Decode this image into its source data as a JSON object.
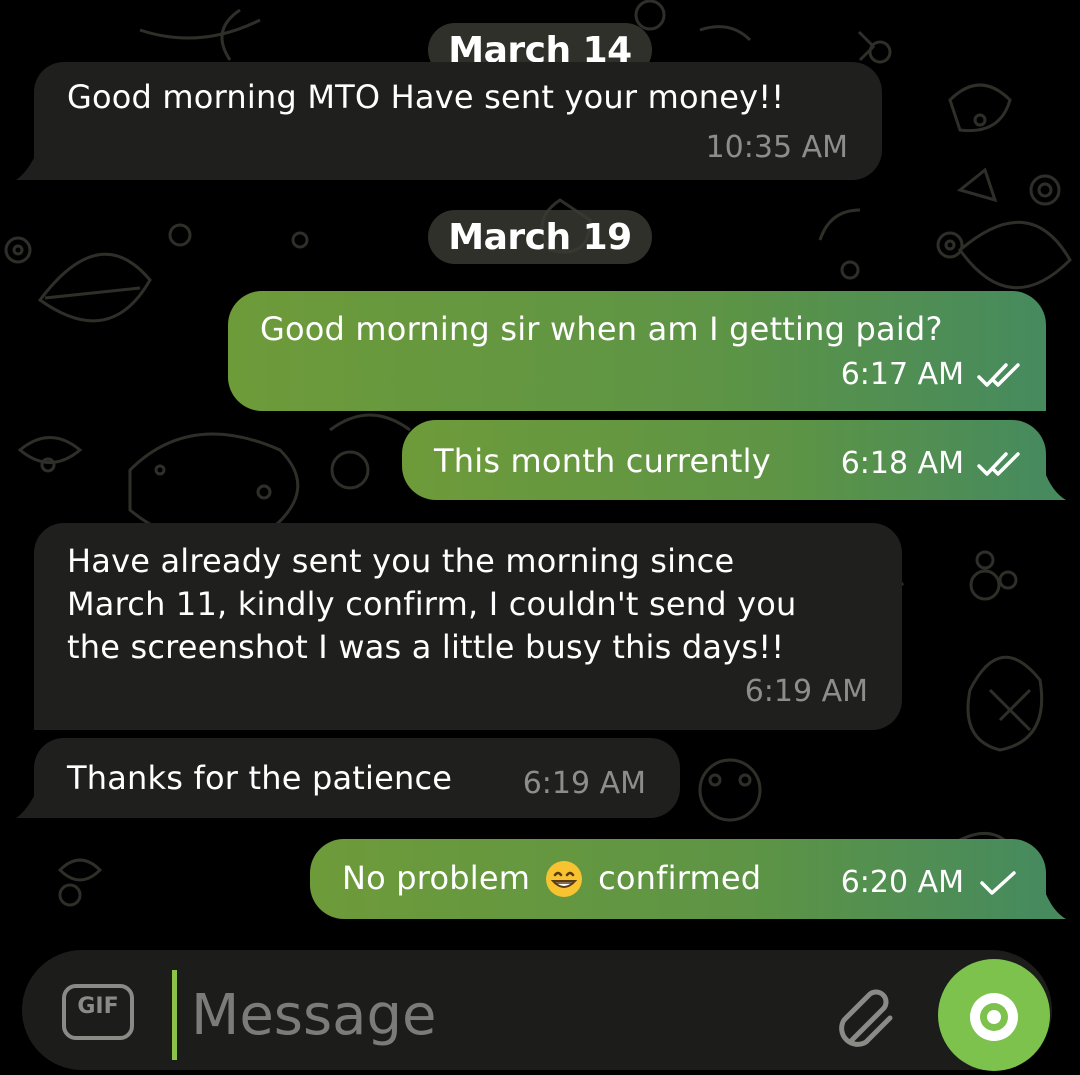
{
  "theme": {
    "background": "#000000",
    "incoming_bubble": "#1f201e",
    "outgoing_bubble_start": "#6e9b3a",
    "outgoing_bubble_end": "#468a5e",
    "accent": "#7cc24c"
  },
  "dates": [
    "March 14",
    "March 19"
  ],
  "messages": [
    {
      "direction": "in",
      "text": "Good morning MTO Have sent your money!!",
      "time": "10:35 AM"
    },
    {
      "direction": "out",
      "text": "Good morning sir when am I getting paid?",
      "time": "6:17 AM",
      "status": "double-check-icon"
    },
    {
      "direction": "out",
      "text": "This month currently",
      "time": "6:18 AM",
      "status": "double-check-icon"
    },
    {
      "direction": "in",
      "lines": [
        "Have already sent you the morning since",
        "March 11, kindly confirm, I couldn't send you",
        "the screenshot I was a little busy this days!!"
      ],
      "time": "6:19 AM"
    },
    {
      "direction": "in",
      "text": "Thanks for the patience",
      "time": "6:19 AM"
    },
    {
      "direction": "out",
      "text_before": "No problem",
      "emoji": "grinning-face-icon",
      "text_after": "confirmed",
      "time": "6:20 AM",
      "status": "single-check-icon"
    }
  ],
  "composer": {
    "placeholder": "Message",
    "gif_label": "GIF",
    "icons": [
      "gif-icon",
      "paperclip-icon",
      "camera-icon"
    ]
  }
}
